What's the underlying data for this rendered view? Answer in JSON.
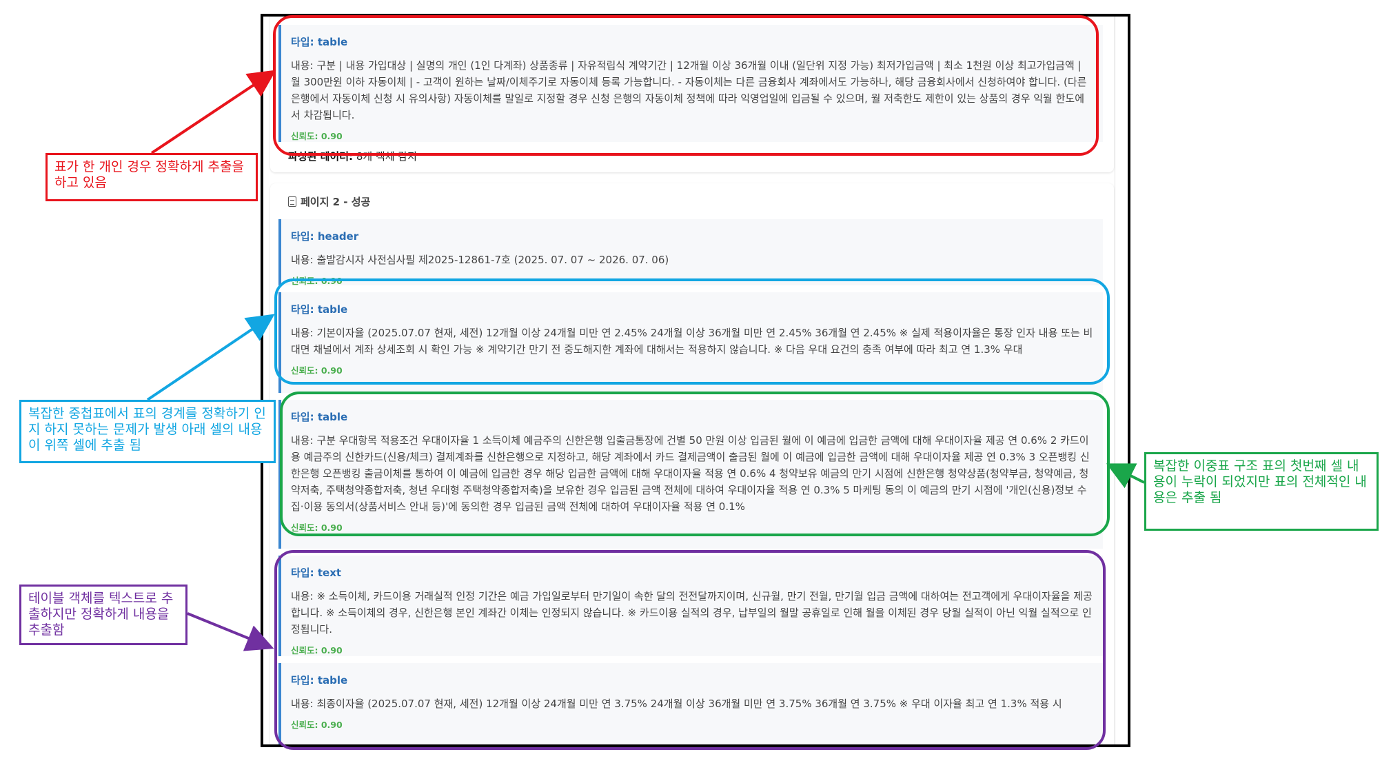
{
  "labels": {
    "type_prefix": "타입:",
    "content_prefix": "내용:",
    "confidence_prefix": "신뢰도:"
  },
  "page1": {
    "items": [
      {
        "type": "table",
        "content": "구분 | 내용 가입대상 | 실명의 개인 (1인 다계좌) 상품종류 | 자유적립식 계약기간 | 12개월 이상 36개월 이내 (일단위 지정 가능) 최저가입금액 | 최소 1천원 이상 최고가입금액 | 월 300만원 이하 자동이체 | - 고객이 원하는 날짜/이체주기로 자동이체 등록 가능합니다. - 자동이체는 다른 금융회사 계좌에서도 가능하나, 해당 금융회사에서 신청하여야 합니다. (다른 은행에서 자동이체 신청 시 유의사항) 자동이체를 말일로 지정할 경우 신청 은행의 자동이체 정책에 따라 익영업일에 입금될 수 있으며, 월 저축한도 제한이 있는 상품의 경우 익월 한도에서 차감됩니다.",
        "confidence": "0.90"
      }
    ],
    "parsed_label": "파싱된 데이터:",
    "parsed_value": "8개 객체 감지"
  },
  "page2": {
    "title": "페이지 2 - 성공",
    "items": [
      {
        "type": "header",
        "content": "출발감시자 사전심사필 제2025-12861-7호 (2025. 07. 07 ~ 2026. 07. 06)",
        "confidence": "0.90"
      },
      {
        "type": "table",
        "content": "기본이자율 (2025.07.07 현재, 세전) 12개월 이상 24개월 미만 연 2.45% 24개월 이상 36개월 미만 연 2.45% 36개월 연 2.45% ※ 실제 적용이자율은 통장 인자 내용 또는 비대면 채널에서 계좌 상세조회 시 확인 가능 ※ 계약기간 만기 전 중도해지한 계좌에 대해서는 적용하지 않습니다. ※ 다음 우대 요건의 충족 여부에 따라 최고 연 1.3% 우대",
        "confidence": "0.90"
      },
      {
        "type": "table",
        "content": "구분 우대항목 적용조건 우대이자율 1 소득이체 예금주의 신한은행 입출금통장에 건별 50 만원 이상 입금된 월에 이 예금에 입금한 금액에 대해 우대이자율 제공 연 0.6% 2 카드이용 예금주의 신한카드(신용/체크) 결제계좌를 신한은행으로 지정하고, 해당 계좌에서 카드 결제금액이 출금된 월에 이 예금에 입금한 금액에 대해 우대이자율 제공 연 0.3% 3 오픈뱅킹 신한은행 오픈뱅킹 출금이체를 통하여 이 예금에 입금한 경우 해당 입금한 금액에 대해 우대이자율 적용 연 0.6% 4 청약보유 예금의 만기 시점에 신한은행 청약상품(청약부금, 청약예금, 청약저축, 주택청약종합저축, 청년 우대형 주택청약종합저축)을 보유한 경우 입금된 금액 전체에 대하여 우대이자율 적용 연 0.3% 5 마케팅 동의 이 예금의 만기 시점에 '개인(신용)정보 수집·이용 동의서(상품서비스 안내 등)'에 동의한 경우 입금된 금액 전체에 대하여 우대이자율 적용 연 0.1%",
        "confidence": "0.90"
      },
      {
        "type": "text",
        "content": "※ 소득이체, 카드이용 거래실적 인정 기간은 예금 가입일로부터 만기일이 속한 달의 전전달까지이며, 신규월, 만기 전월, 만기월 입금 금액에 대하여는 전고객에게 우대이자율을 제공합니다. ※ 소득이체의 경우, 신한은행 본인 계좌간 이체는 인정되지 않습니다. ※ 카드이용 실적의 경우, 납부일의 월말 공휴일로 인해 월을 이체된 경우 당월 실적이 아닌 익월 실적으로 인정됩니다.",
        "confidence": "0.90"
      },
      {
        "type": "table",
        "content": "최종이자율 (2025.07.07 현재, 세전) 12개월 이상 24개월 미만 연 3.75% 24개월 이상 36개월 미만 연 3.75% 36개월 연 3.75% ※ 우대 이자율 최고 연 1.3% 적용 시",
        "confidence": "0.90"
      }
    ]
  },
  "annotations": [
    {
      "text": "표가 한 개인 경우 정확하게 추출을 하고 있음",
      "color": "#e8141c"
    },
    {
      "text": "복잡한 중첩표에서 표의 경계를 정확하기 인지 하지 못하는 문제가 발생 아래 셀의 내용이 위쪽 셀에 추출 됨",
      "color": "#12a6e2"
    },
    {
      "text": "테이블 객체를 텍스트로 추출하지만 정확하게 내용을 추출함",
      "color": "#7030a0"
    },
    {
      "text": "복잡한 이중표 구조 표의 첫번째 셀 내용이 누락이 되었지만 표의 전체적인 내용은 추출 됨",
      "color": "#1aa64a"
    }
  ],
  "colors": {
    "red": "#e8141c",
    "blue": "#12a6e2",
    "green": "#1aa64a",
    "purple": "#7030a0",
    "accent": "#3a86d0",
    "confidence": "#4caf50"
  }
}
